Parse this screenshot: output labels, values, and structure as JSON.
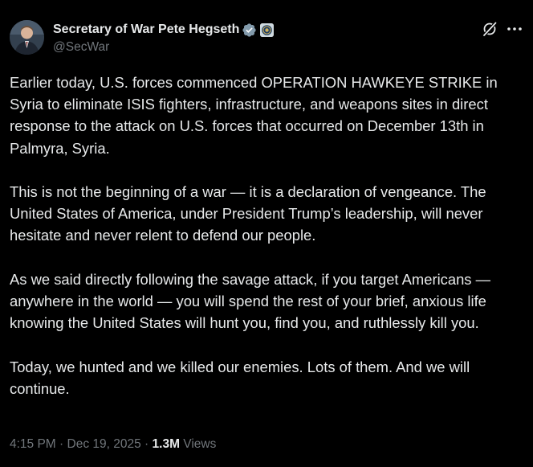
{
  "author": {
    "display_name": "Secretary of War Pete Hegseth",
    "handle": "@SecWar",
    "verified": true,
    "verified_badge_color": "#71767b",
    "affiliate_badge": "government-seal"
  },
  "actions": {
    "grok_icon": "grok-icon",
    "more_icon": "more-options-icon"
  },
  "post": {
    "paragraphs": [
      "Earlier today, U.S. forces commenced OPERATION HAWKEYE STRIKE in Syria to eliminate ISIS fighters, infrastructure, and weapons sites in direct response to the attack on U.S. forces that occurred on December 13th in Palmyra, Syria.",
      "This is not the beginning of a war — it is a declaration of vengeance. The United States of America, under President Trump’s leadership, will never hesitate and never relent to defend our people.",
      "As we said directly following the savage attack, if you target Americans — anywhere in the world — you will spend the rest of your brief, anxious life knowing the United States will hunt you, find you, and ruthlessly kill you.",
      "Today, we hunted and we killed our enemies. Lots of them. And we will continue."
    ]
  },
  "meta": {
    "time": "4:15 PM",
    "separator": " · ",
    "date": "Dec 19, 2025",
    "views_count": "1.3M",
    "views_label": "Views"
  },
  "colors": {
    "background": "#000000",
    "text": "#e7e9ea",
    "secondary_text": "#71767b"
  }
}
